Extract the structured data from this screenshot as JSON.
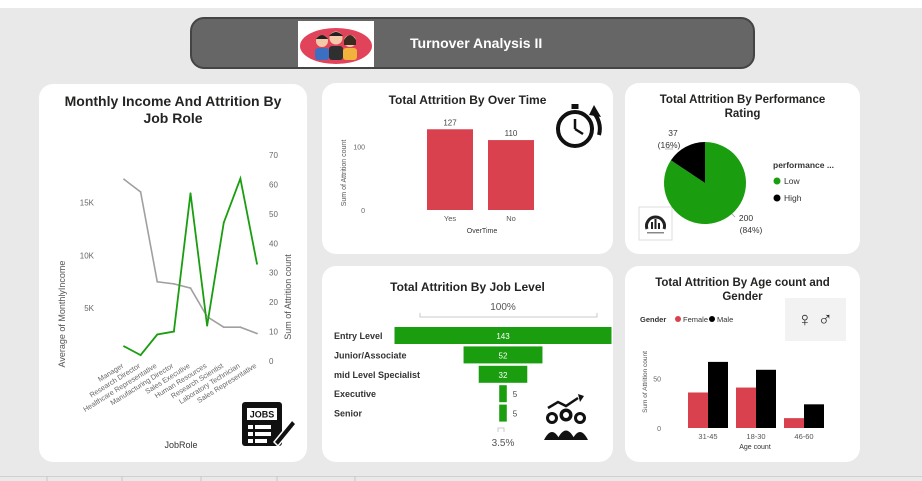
{
  "header": {
    "title": "Turnover Analysis II",
    "logo_icon": "people-group-icon"
  },
  "colors": {
    "red": "#d9414e",
    "green": "#1a9e10",
    "black": "#000000",
    "line_gray": "#a0a0a0"
  },
  "charts": {
    "job_role": {
      "title_line1": "Monthly Income And Attrition By",
      "title_line2": "Job Role",
      "xlabel": "JobRole",
      "ylabel_left": "Average of MonthlyIncome",
      "ylabel_right": "Sum of Attrition count",
      "left_ticks": [
        "15K",
        "10K",
        "5K"
      ],
      "right_ticks": [
        "70",
        "60",
        "50",
        "40",
        "30",
        "20",
        "10",
        "0"
      ],
      "icon": "jobs-clipboard-icon",
      "icon_text": "JOBS"
    },
    "overtime": {
      "title": "Total Attrition By Over Time",
      "ylabel": "Sum of Attrition count",
      "xlabel": "OverTime",
      "icon": "stopwatch-icon"
    },
    "performance": {
      "title_line1": "Total Attrition By Performance",
      "title_line2": "Rating",
      "legend_title": "performance ...",
      "icon": "gauge-icon",
      "label_high": "37",
      "label_high_pct": "(16%)",
      "label_low": "200",
      "label_low_pct": "(84%)"
    },
    "job_level": {
      "title": "Total Attrition By Job Level",
      "top_pct": "100%",
      "bottom_pct": "3.5%",
      "icon": "team-growth-icon"
    },
    "age_gender": {
      "title_line1": "Total Attrition By Age count and",
      "title_line2": "Gender",
      "legend_title": "Gender",
      "ylabel": "Sum of Attrition count",
      "xlabel": "Age count",
      "icon": "gender-symbols-icon",
      "gender_glyphs": "♀ ♂"
    }
  },
  "chart_data": [
    {
      "type": "line",
      "title": "Monthly Income And Attrition By Job Role",
      "xlabel": "JobRole",
      "categories": [
        "Manager",
        "Research Director",
        "Healthcare Representative",
        "Manufacturing Director",
        "Sales Executive",
        "Human Resources",
        "Research Scientist",
        "Laboratory Technician",
        "Sales Representative"
      ],
      "series": [
        {
          "name": "Average of MonthlyIncome",
          "axis": "left",
          "values": [
            17200,
            16000,
            7500,
            7300,
            6900,
            4200,
            3200,
            3200,
            2600
          ]
        },
        {
          "name": "Sum of Attrition count",
          "axis": "right",
          "values": [
            5,
            2,
            9,
            10,
            57,
            12,
            47,
            62,
            33
          ]
        }
      ],
      "ylim_left": [
        0,
        19500
      ],
      "ylim_right": [
        0,
        70
      ]
    },
    {
      "type": "bar",
      "title": "Total Attrition By Over Time",
      "categories": [
        "Yes",
        "No"
      ],
      "values": [
        127,
        110
      ],
      "data_labels": [
        "127",
        "110"
      ],
      "y_ticks": [
        0,
        100
      ],
      "ylim": [
        0,
        140
      ],
      "xlabel": "OverTime",
      "ylabel": "Sum of Attrition count"
    },
    {
      "type": "pie",
      "title": "Total Attrition By Performance Rating",
      "legend_title": "performance ...",
      "legend_position": "right",
      "slices": [
        {
          "label": "Low",
          "value": 200,
          "percent": 84
        },
        {
          "label": "High",
          "value": 37,
          "percent": 16
        }
      ]
    },
    {
      "type": "bar",
      "orientation": "funnel",
      "title": "Total Attrition By Job Level",
      "categories": [
        "Entry Level",
        "Junior/Associate",
        "mid Level Specialist",
        "Executive",
        "Senior"
      ],
      "values": [
        143,
        52,
        32,
        5,
        5
      ]
    },
    {
      "type": "bar",
      "title": "Total Attrition By Age count and Gender",
      "categories": [
        "31-45",
        "18-30",
        "46-60"
      ],
      "series": [
        {
          "name": "Female",
          "values": [
            36,
            41,
            10
          ]
        },
        {
          "name": "Male",
          "values": [
            67,
            59,
            24
          ]
        }
      ],
      "y_ticks": [
        0,
        50
      ],
      "ylim": [
        0,
        75
      ],
      "xlabel": "Age count",
      "ylabel": "Sum of Attrition count",
      "legend_title": "Gender",
      "legend_position": "top-left"
    }
  ]
}
